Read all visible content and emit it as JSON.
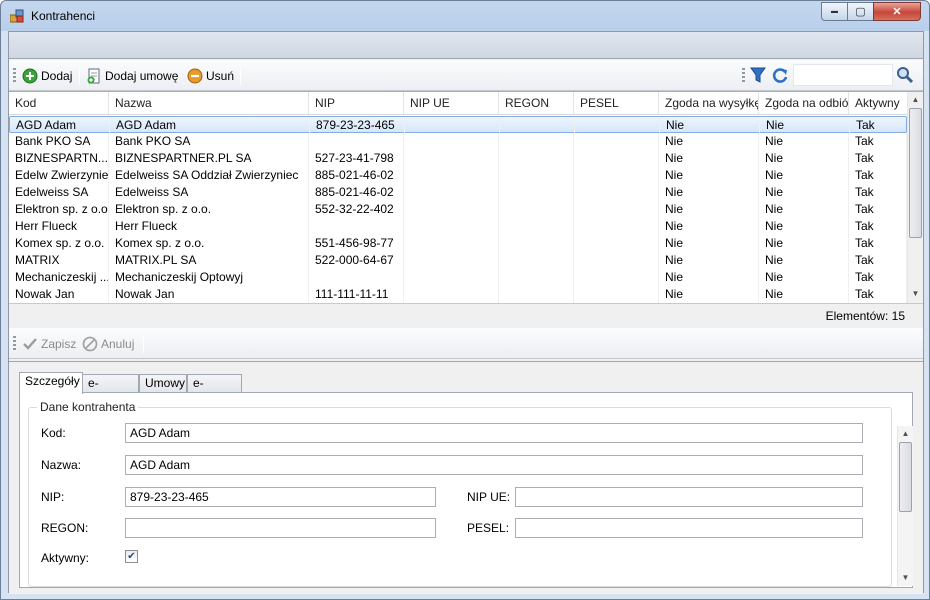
{
  "window": {
    "title": "Kontrahenci",
    "minimize": "▬",
    "maximize": "▢",
    "close": "✕"
  },
  "toolbar": {
    "add": "Dodaj",
    "add_contract": "Dodaj umowę",
    "delete": "Usuń"
  },
  "grid": {
    "columns": [
      "Kod",
      "Nazwa",
      "NIP",
      "NIP UE",
      "REGON",
      "PESEL",
      "Zgoda na wysyłkę",
      "Zgoda na odbiór",
      "Aktywny"
    ],
    "rows": [
      [
        "AGD Adam",
        "AGD Adam",
        "879-23-23-465",
        "",
        "",
        "",
        "Nie",
        "Nie",
        "Tak"
      ],
      [
        "Bank PKO SA",
        "Bank PKO SA",
        "",
        "",
        "",
        "",
        "Nie",
        "Nie",
        "Tak"
      ],
      [
        "BIZNESPARTN...",
        "BIZNESPARTNER.PL SA",
        "527-23-41-798",
        "",
        "",
        "",
        "Nie",
        "Nie",
        "Tak"
      ],
      [
        "Edelw Zwierzyniec",
        "Edelweiss SA Oddział Zwierzyniec",
        "885-021-46-02",
        "",
        "",
        "",
        "Nie",
        "Nie",
        "Tak"
      ],
      [
        "Edelweiss SA",
        "Edelweiss SA",
        "885-021-46-02",
        "",
        "",
        "",
        "Nie",
        "Nie",
        "Tak"
      ],
      [
        "Elektron sp. z o.o.",
        "Elektron sp. z o.o.",
        "552-32-22-402",
        "",
        "",
        "",
        "Nie",
        "Nie",
        "Tak"
      ],
      [
        "Herr Flueck",
        "Herr Flueck",
        "",
        "",
        "",
        "",
        "Nie",
        "Nie",
        "Tak"
      ],
      [
        "Komex sp. z o.o.",
        "Komex sp. z o.o.",
        "551-456-98-77",
        "",
        "",
        "",
        "Nie",
        "Nie",
        "Tak"
      ],
      [
        "MATRIX",
        "MATRIX.PL SA",
        "522-000-64-67",
        "",
        "",
        "",
        "Nie",
        "Nie",
        "Tak"
      ],
      [
        "Mechaniczeskij ...",
        "Mechaniczeskij Optowyj",
        "",
        "",
        "",
        "",
        "Nie",
        "Nie",
        "Tak"
      ],
      [
        "Nowak Jan",
        "Nowak Jan",
        "111-111-11-11",
        "",
        "",
        "",
        "Nie",
        "Nie",
        "Tak"
      ]
    ],
    "count": "Elementów: 15"
  },
  "edit_toolbar": {
    "save": "Zapisz",
    "cancel": "Anuluj"
  },
  "tabs": [
    "Szczegóły",
    "e-Podpisy",
    "Umowy",
    "e-Faktury"
  ],
  "details": {
    "group_title": "Dane kontrahenta",
    "kod_label": "Kod:",
    "kod_value": "AGD Adam",
    "nazwa_label": "Nazwa:",
    "nazwa_value": "AGD Adam",
    "nip_label": "NIP:",
    "nip_value": "879-23-23-465",
    "nipue_label": "NIP UE:",
    "nipue_value": "",
    "regon_label": "REGON:",
    "regon_value": "",
    "pesel_label": "PESEL:",
    "pesel_value": "",
    "aktywny_label": "Aktywny:",
    "aktywny_mark": "✔"
  }
}
